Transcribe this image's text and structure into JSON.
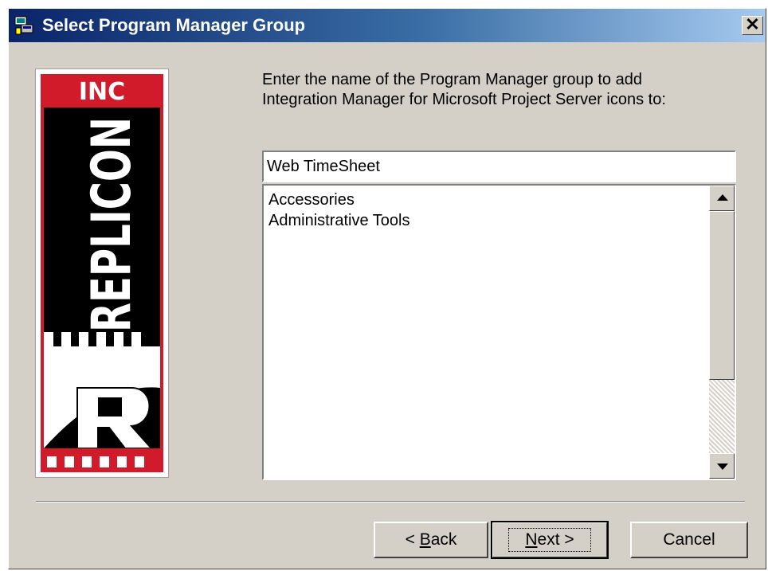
{
  "window": {
    "title": "Select Program Manager Group",
    "close_symbol": "✕",
    "title_icon": "setup-icon"
  },
  "logo": {
    "top_text": "INC",
    "brand": "REPLICON",
    "monogram": "R",
    "colors": {
      "red": "#d11a2a",
      "black": "#000000",
      "white": "#ffffff"
    }
  },
  "prompt": {
    "line1": "Enter the name of the Program Manager group to add",
    "line2": "Integration Manager for Microsoft Project Server icons to:"
  },
  "group_input": {
    "value": "Web TimeSheet"
  },
  "group_list": {
    "items": [
      "Accessories",
      "Administrative Tools"
    ]
  },
  "buttons": {
    "back": {
      "prefix": "< ",
      "mnemonic": "B",
      "rest": "ack"
    },
    "next": {
      "mnemonic": "N",
      "rest": "ext >"
    },
    "cancel": "Cancel"
  },
  "colors": {
    "dialog_bg": "#d4d0c8",
    "title_gradient_start": "#0a246a",
    "title_gradient_end": "#a6caf0"
  }
}
